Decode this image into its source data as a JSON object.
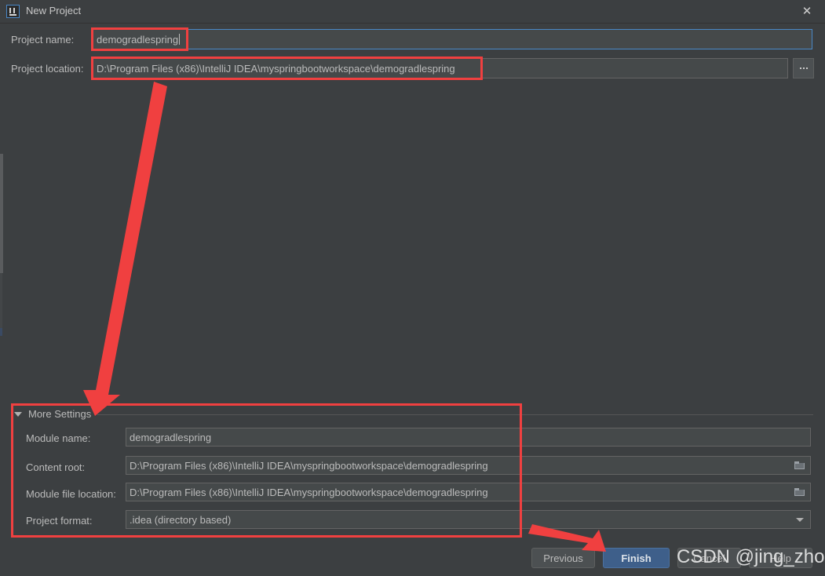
{
  "window": {
    "title": "New Project",
    "app_icon": "intellij-idea-icon",
    "close_label": "✕"
  },
  "form": {
    "project_name": {
      "label": "Project name:",
      "value": "demogradlespring",
      "focused": true
    },
    "project_location": {
      "label": "Project location:",
      "value": "D:\\Program Files (x86)\\IntelliJ IDEA\\myspringbootworkspace\\demogradlespring",
      "browse_label": "..."
    }
  },
  "more_settings": {
    "label": "More Settings",
    "expanded": true,
    "rows": [
      {
        "label": "Module name:",
        "value": "demogradlespring",
        "trailing_icon": "none"
      },
      {
        "label": "Content root:",
        "value": "D:\\Program Files (x86)\\IntelliJ IDEA\\myspringbootworkspace\\demogradlespring",
        "trailing_icon": "folder-icon"
      },
      {
        "label": "Module file location:",
        "value": "D:\\Program Files (x86)\\IntelliJ IDEA\\myspringbootworkspace\\demogradlespring",
        "trailing_icon": "folder-icon"
      },
      {
        "label": "Project format:",
        "value": ".idea (directory based)",
        "trailing_icon": "chevron-down-icon"
      }
    ]
  },
  "footer": {
    "previous": "Previous",
    "finish": "Finish",
    "cancel": "Cancel",
    "help": "Help"
  },
  "annotations": {
    "watermark": "CSDN @jing_zhong",
    "highlight_color": "#f04040"
  },
  "theme": {
    "window_bg": "#3c3f41",
    "field_bg": "#45494a",
    "field_border": "#646464",
    "focus_border": "#4a88c7",
    "text": "#bbbbbb",
    "primary_button_bg": "#3e5f8a"
  }
}
